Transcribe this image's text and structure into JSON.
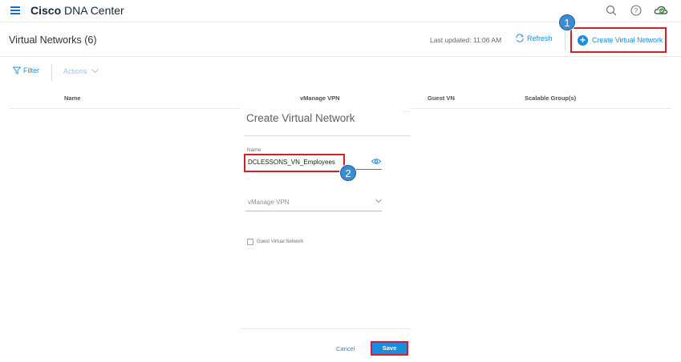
{
  "app": {
    "brand_bold": "Cisco",
    "brand_rest": "DNA Center"
  },
  "top_icons": [
    "search-icon",
    "help-icon",
    "cloud-status-icon"
  ],
  "header": {
    "title": "Virtual Networks (6)",
    "last_updated": "Last updated: 11:06 AM",
    "refresh_label": "Refresh",
    "create_label": "Create Virtual Network"
  },
  "toolbar": {
    "filter_label": "Filter",
    "actions_label": "Actions"
  },
  "table": {
    "columns": [
      "Name",
      "vManage VPN",
      "Guest VN",
      "Scalable Group(s)"
    ]
  },
  "panel": {
    "title": "Create Virtual Network",
    "more": "···",
    "name_label": "Name",
    "name_value": "DCLESSONS_VN_Employees",
    "vmanage_placeholder": "vManage VPN",
    "guest_label": "Guest Virtual Network",
    "cancel_label": "Cancel",
    "save_label": "Save"
  },
  "markers": {
    "one": "1",
    "two": "2"
  },
  "colors": {
    "accent": "#1b8ddc",
    "highlight": "#d32028",
    "marker": "#3d8bd4"
  }
}
